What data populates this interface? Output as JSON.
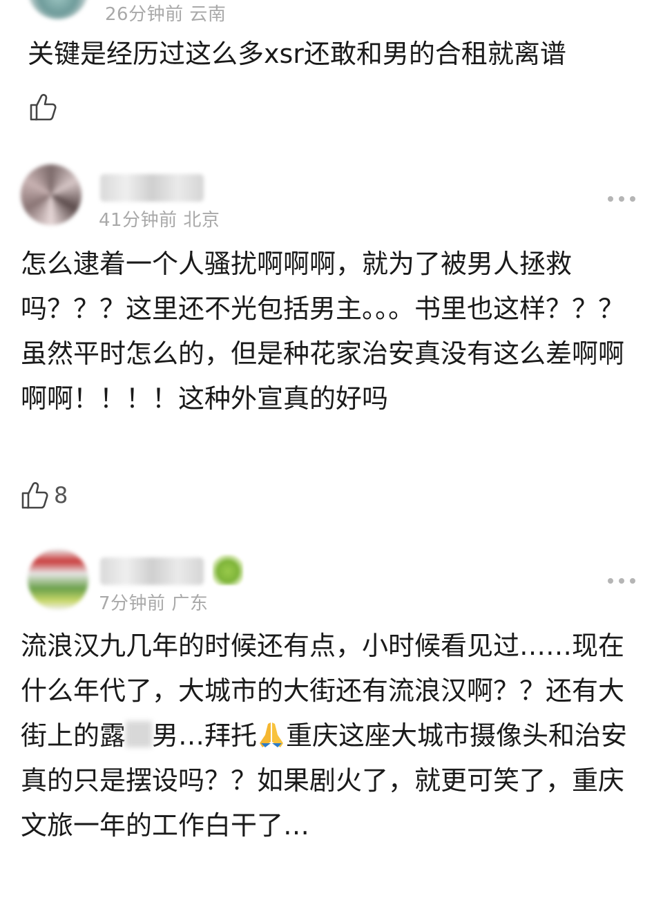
{
  "comments": [
    {
      "time": "26分钟前",
      "location": "云南",
      "text": "关键是经历过这么多xsr还敢和男的合租就离谱",
      "likes": ""
    },
    {
      "time": "41分钟前",
      "location": "北京",
      "text": "怎么逮着一个人骚扰啊啊啊，就为了被男人拯救吗？？？这里还不光包括男主。。。书里也这样？？？虽然平时怎么的，但是种花家治安真没有这么差啊啊啊啊！！！！这种外宣真的好吗",
      "likes": "8"
    },
    {
      "time": "7分钟前",
      "location": "广东",
      "text_before_blur": "流浪汉九几年的时候还有点，小时候看见过……现在什么年代了，大城市的大街还有流浪汉啊？？还有大街上的露",
      "text_after_blur": "男…拜托",
      "text_after_emoji": "重庆这座大城市摄像头和治安真的只是摆设吗？？如果剧火了，就更可笑了，重庆文旅一年的工作白干了…",
      "emoji": "folded-hands-emoji"
    }
  ],
  "colors": {
    "text": "#1a1a1a",
    "meta": "#a9a9a9",
    "icon": "#444444"
  }
}
